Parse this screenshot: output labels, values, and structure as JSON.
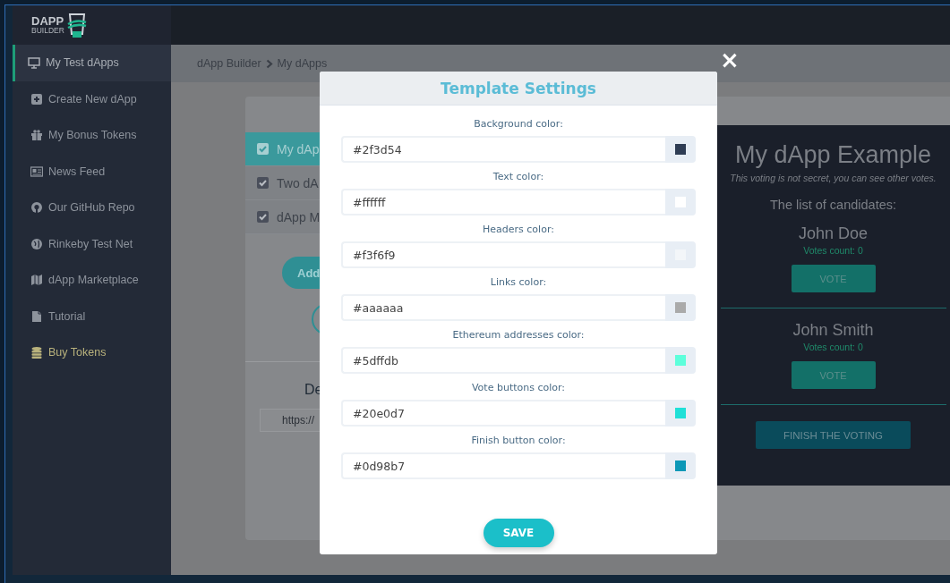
{
  "logo": {
    "line1": "DAPP",
    "line2": "BUILDER"
  },
  "sidebar": {
    "items": [
      {
        "label": "My Test dApps",
        "selected": true,
        "kind": "link"
      },
      {
        "label": "Create New dApp",
        "selected": false,
        "kind": "link"
      },
      {
        "label": "My Bonus Tokens",
        "selected": false,
        "kind": "link"
      },
      {
        "label": "News Feed",
        "selected": false,
        "kind": "link"
      },
      {
        "label": "Our GitHub Repo",
        "selected": false,
        "kind": "link"
      },
      {
        "label": "Rinkeby Test Net",
        "selected": false,
        "kind": "link"
      },
      {
        "label": "dApp Marketplace",
        "selected": false,
        "kind": "link"
      },
      {
        "label": "Tutorial",
        "selected": false,
        "kind": "link"
      },
      {
        "label": "Buy Tokens",
        "selected": false,
        "kind": "promo"
      }
    ]
  },
  "breadcrumb": [
    "dApp Builder",
    "My dApps"
  ],
  "dapps": [
    {
      "label": "My dAp",
      "checked": true,
      "selected": true
    },
    {
      "label": "Two dA",
      "checked": true,
      "selected": false
    },
    {
      "label": "dApp M",
      "checked": true,
      "selected": false
    }
  ],
  "add_button": "Add",
  "deploy": {
    "heading": "De",
    "url": "https://"
  },
  "preview": {
    "title": "My dApp Example",
    "subtitle": "This voting is not secret, you can see other votes.",
    "list_heading": "The list of candidates:",
    "candidates": [
      {
        "name": "John Doe",
        "votes": "Votes count: 0",
        "button": "VOTE"
      },
      {
        "name": "John Smith",
        "votes": "Votes count: 0",
        "button": "VOTE"
      }
    ],
    "finish_button": "FINISH THE VOTING"
  },
  "modal": {
    "title": "Template Settings",
    "close": "×",
    "fields": [
      {
        "label": "Background color:",
        "value": "#2f3d54",
        "color": "#2f3d54"
      },
      {
        "label": "Text color:",
        "value": "#ffffff",
        "color": "#ffffff"
      },
      {
        "label": "Headers color:",
        "value": "#f3f6f9",
        "color": "#f3f6f9"
      },
      {
        "label": "Links color:",
        "value": "#aaaaaa",
        "color": "#aaaaaa"
      },
      {
        "label": "Ethereum addresses color:",
        "value": "#5dffdb",
        "color": "#5dffdb"
      },
      {
        "label": "Vote buttons color:",
        "value": "#20e0d7",
        "color": "#20e0d7"
      },
      {
        "label": "Finish button color:",
        "value": "#0d98b7",
        "color": "#0d98b7"
      }
    ],
    "save_button": "SAVE"
  }
}
